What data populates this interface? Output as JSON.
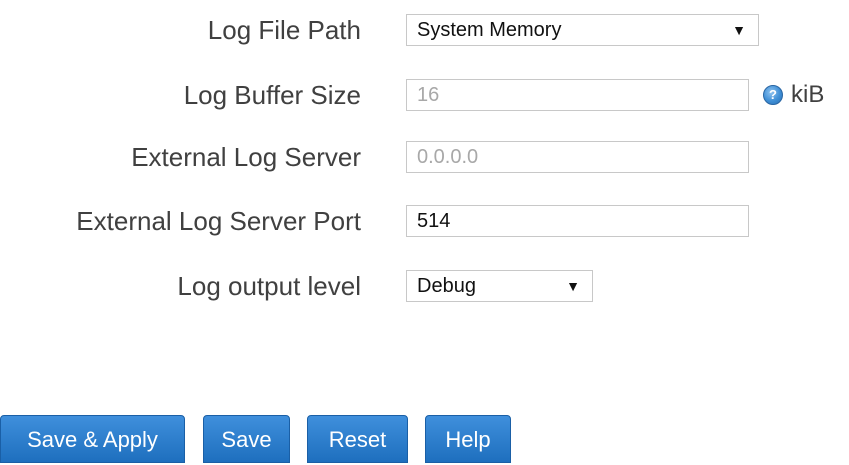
{
  "form": {
    "log_file_path": {
      "label": "Log File Path",
      "value": "System Memory"
    },
    "log_buffer_size": {
      "label": "Log Buffer Size",
      "value": "16",
      "unit": "kiB",
      "help_icon": "?"
    },
    "external_log_server": {
      "label": "External Log Server",
      "value": "0.0.0.0"
    },
    "external_log_server_port": {
      "label": "External Log Server Port",
      "value": "514"
    },
    "log_output_level": {
      "label": "Log output level",
      "value": "Debug"
    }
  },
  "buttons": {
    "save_apply": "Save & Apply",
    "save": "Save",
    "reset": "Reset",
    "help": "Help"
  },
  "icons": {
    "dropdown_arrow": "▼",
    "help": "help-icon"
  },
  "colors": {
    "button_blue": "#2a7fd0",
    "label_text": "#404040",
    "disabled_text": "#a8a8a8"
  }
}
